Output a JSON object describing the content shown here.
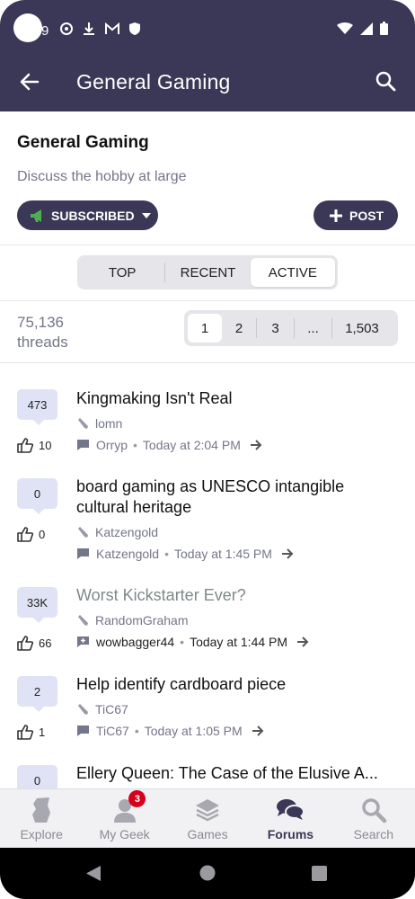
{
  "status_bar": {
    "time": "9"
  },
  "app_bar": {
    "title": "General Gaming"
  },
  "forum": {
    "title": "General Gaming",
    "description": "Discuss the hobby at large",
    "subscribed_label": "SUBSCRIBED",
    "post_label": "POST"
  },
  "sort_tabs": [
    {
      "label": "TOP",
      "active": false
    },
    {
      "label": "RECENT",
      "active": false
    },
    {
      "label": "ACTIVE",
      "active": true
    }
  ],
  "thread_count": {
    "value": "75,136",
    "label": "threads"
  },
  "pagination": [
    "1",
    "2",
    "3",
    "...",
    "1,503"
  ],
  "threads": [
    {
      "replies": "473",
      "likes": "10",
      "title": "Kingmaking Isn't Real",
      "author": "lomn",
      "last_poster": "Orryp",
      "time": "Today at 2:04 PM",
      "visited": false
    },
    {
      "replies": "0",
      "likes": "0",
      "title": "board gaming as UNESCO intangible cultural heritage",
      "author": "Katzengold",
      "last_poster": "Katzengold",
      "time": "Today at 1:45 PM",
      "visited": false
    },
    {
      "replies": "33K",
      "likes": "66",
      "title": "Worst Kickstarter Ever?",
      "author": "RandomGraham",
      "last_poster": "wowbagger44",
      "time": "Today at 1:44 PM",
      "visited": true
    },
    {
      "replies": "2",
      "likes": "1",
      "title": "Help identify cardboard piece",
      "author": "TiC67",
      "last_poster": "TiC67",
      "time": "Today at 1:05 PM",
      "visited": false
    },
    {
      "replies": "0",
      "title": "Ellery Queen: The Case of the Elusive A..."
    }
  ],
  "bottom_nav": [
    {
      "label": "Explore",
      "icon": "explore-icon"
    },
    {
      "label": "My Geek",
      "icon": "user-icon",
      "badge": "3"
    },
    {
      "label": "Games",
      "icon": "layers-icon"
    },
    {
      "label": "Forums",
      "icon": "forums-icon",
      "active": true
    },
    {
      "label": "Search",
      "icon": "search-icon"
    }
  ],
  "colors": {
    "primary": "#3b3756",
    "bubble": "#dfe3f5",
    "badge": "#d6001c",
    "megaphone": "#4caf50"
  }
}
